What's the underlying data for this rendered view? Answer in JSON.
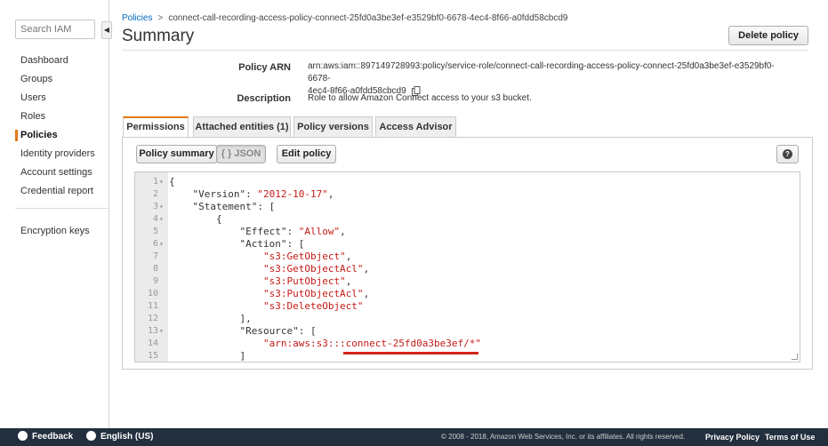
{
  "sidebar": {
    "search_placeholder": "Search IAM",
    "collapse_glyph": "◀",
    "items": [
      {
        "label": "Dashboard"
      },
      {
        "label": "Groups"
      },
      {
        "label": "Users"
      },
      {
        "label": "Roles"
      },
      {
        "label": "Policies",
        "active": true
      },
      {
        "label": "Identity providers"
      },
      {
        "label": "Account settings"
      },
      {
        "label": "Credential report"
      }
    ],
    "bottom_items": [
      {
        "label": "Encryption keys"
      }
    ]
  },
  "breadcrumb": {
    "root": "Policies",
    "separator": ">",
    "current": "connect-call-recording-access-policy-connect-25fd0a3be3ef-e3529bf0-6678-4ec4-8f66-a0fdd58cbcd9"
  },
  "page": {
    "title": "Summary",
    "delete_label": "Delete policy"
  },
  "summary": {
    "arn_label": "Policy ARN",
    "arn_line1": "arn:aws:iam::897149728993:policy/service-role/connect-call-recording-access-policy-connect-25fd0a3be3ef-e3529bf0-6678-",
    "arn_line2": "4ec4-8f66-a0fdd58cbcd9",
    "description_label": "Description",
    "description_value": "Role to allow Amazon Connect access to your s3 bucket."
  },
  "tabs": [
    {
      "label": "Permissions",
      "active": true
    },
    {
      "label": "Attached entities (1)"
    },
    {
      "label": "Policy versions"
    },
    {
      "label": "Access Advisor"
    }
  ],
  "toolbar": {
    "summary_label": "Policy summary",
    "json_label": "{ } JSON",
    "edit_label": "Edit policy",
    "help_glyph": "?"
  },
  "editor": {
    "lines": [
      {
        "n": "1",
        "fold": "▾",
        "indent": "",
        "parts": [
          [
            "k",
            "{"
          ]
        ]
      },
      {
        "n": "2",
        "fold": "",
        "indent": "    ",
        "parts": [
          [
            "k",
            "\"Version\": "
          ],
          [
            "s",
            "\"2012-10-17\""
          ],
          [
            "k",
            ","
          ]
        ]
      },
      {
        "n": "3",
        "fold": "▾",
        "indent": "    ",
        "parts": [
          [
            "k",
            "\"Statement\": ["
          ]
        ]
      },
      {
        "n": "4",
        "fold": "▾",
        "indent": "        ",
        "parts": [
          [
            "k",
            "{"
          ]
        ]
      },
      {
        "n": "5",
        "fold": "",
        "indent": "            ",
        "parts": [
          [
            "k",
            "\"Effect\": "
          ],
          [
            "s",
            "\"Allow\""
          ],
          [
            "k",
            ","
          ]
        ]
      },
      {
        "n": "6",
        "fold": "▾",
        "indent": "            ",
        "parts": [
          [
            "k",
            "\"Action\": ["
          ]
        ]
      },
      {
        "n": "7",
        "fold": "",
        "indent": "                ",
        "parts": [
          [
            "s",
            "\"s3:GetObject\""
          ],
          [
            "k",
            ","
          ]
        ]
      },
      {
        "n": "8",
        "fold": "",
        "indent": "                ",
        "parts": [
          [
            "s",
            "\"s3:GetObjectAcl\""
          ],
          [
            "k",
            ","
          ]
        ]
      },
      {
        "n": "9",
        "fold": "",
        "indent": "                ",
        "parts": [
          [
            "s",
            "\"s3:PutObject\""
          ],
          [
            "k",
            ","
          ]
        ]
      },
      {
        "n": "10",
        "fold": "",
        "indent": "                ",
        "parts": [
          [
            "s",
            "\"s3:PutObjectAcl\""
          ],
          [
            "k",
            ","
          ]
        ]
      },
      {
        "n": "11",
        "fold": "",
        "indent": "                ",
        "parts": [
          [
            "s",
            "\"s3:DeleteObject\""
          ]
        ]
      },
      {
        "n": "12",
        "fold": "",
        "indent": "            ",
        "parts": [
          [
            "k",
            "],"
          ]
        ]
      },
      {
        "n": "13",
        "fold": "▾",
        "indent": "            ",
        "parts": [
          [
            "k",
            "\"Resource\": ["
          ]
        ]
      },
      {
        "n": "14",
        "fold": "",
        "indent": "                ",
        "parts": [
          [
            "s",
            "\"arn:aws:s3:::connect-25fd0a3be3ef/*\""
          ]
        ]
      },
      {
        "n": "15",
        "fold": "",
        "indent": "            ",
        "parts": [
          [
            "k",
            "]"
          ]
        ]
      }
    ]
  },
  "colors": {
    "accent": "#e47911",
    "annotation": "#d2251a",
    "footer_bg": "#232f3e"
  },
  "footer": {
    "feedback": "Feedback",
    "language": "English (US)",
    "copyright": "© 2008 - 2018, Amazon Web Services, Inc. or its affiliates. All rights reserved.",
    "privacy": "Privacy Policy",
    "terms": "Terms of Use"
  }
}
